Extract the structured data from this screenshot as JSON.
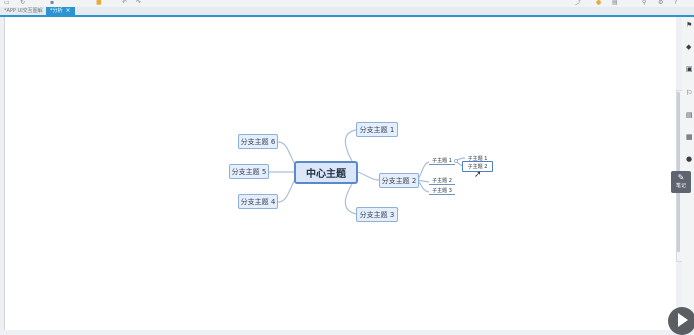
{
  "tabs": [
    {
      "label": "*APP UI交互图解",
      "active": false
    },
    {
      "label": "*分析",
      "active": true
    }
  ],
  "right_panel": {
    "pen_label": "笔记"
  },
  "mindmap": {
    "central": "中心主题",
    "branches": {
      "b1": "分支主题 1",
      "b2": "分支主题 2",
      "b3": "分支主题 3",
      "b4": "分支主题 4",
      "b5": "分支主题 5",
      "b6": "分支主题 6"
    },
    "subtopics": {
      "s1": "子主题 1",
      "s2": "子主题 2",
      "s3": "子主题 3",
      "s11": "子主题 1",
      "s12": "子主题 2"
    }
  },
  "colors": {
    "accent": "#2c95d1",
    "node_border": "#8eb1dc",
    "node_fill": "#e5eefb"
  }
}
